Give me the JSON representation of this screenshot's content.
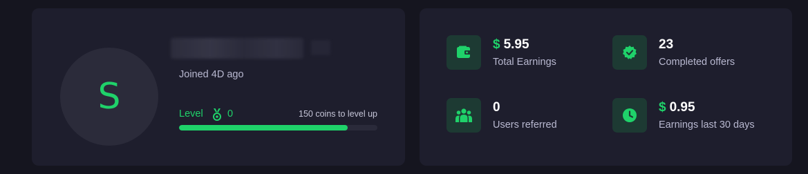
{
  "colors": {
    "accent": "#1fd26a",
    "card_bg": "#1e1e2d",
    "page_bg": "#15151f",
    "icon_box_bg": "#1d3a33"
  },
  "profile": {
    "avatar_letter": "S",
    "joined": "Joined 4D ago",
    "level_label": "Level",
    "level_icon": "medal-icon",
    "level_value": "0",
    "level_up_text": "150 coins to level up",
    "progress_fraction": 0.85
  },
  "stats": [
    {
      "icon": "wallet-icon",
      "currency": "$",
      "value": "5.95",
      "label": "Total Earnings"
    },
    {
      "icon": "verified-badge-icon",
      "currency": "",
      "value": "23",
      "label": "Completed offers"
    },
    {
      "icon": "users-icon",
      "currency": "",
      "value": "0",
      "label": "Users referred"
    },
    {
      "icon": "clock-icon",
      "currency": "$",
      "value": "0.95",
      "label": "Earnings last 30 days"
    }
  ]
}
